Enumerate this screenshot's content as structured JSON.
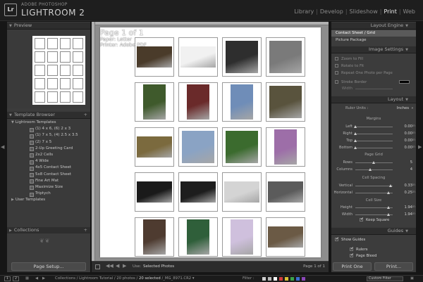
{
  "app": {
    "vendor": "ADOBE PHOTOSHOP",
    "name": "LIGHTROOM 2",
    "logo": "Lr",
    "modules": [
      "Library",
      "Develop",
      "Slideshow",
      "Print",
      "Web"
    ],
    "active_module": "Print"
  },
  "left": {
    "preview_title": "Preview",
    "template_browser_title": "Template Browser",
    "template_folder": "Lightroom Templates",
    "templates": [
      "(1) 4 x 6, (6) 2 x 3",
      "(1) 7 x 5, (4) 2.5 x 3.5",
      "(2) 7 x 5",
      "2-Up Greeting Card",
      "2x2 Cells",
      "4 Wide",
      "4x5 Contact Sheet",
      "5x8 Contact Sheet",
      "Fine Art Mat",
      "Maximize Size",
      "Triptych"
    ],
    "user_folder": "User Templates",
    "collections_title": "Collections",
    "page_setup_button": "Page Setup..."
  },
  "canvas": {
    "page_label": "Page 1 of 1",
    "paper_label": "Paper: Letter",
    "printer_label": "Printer: Adobe PDF"
  },
  "toolbar": {
    "use_label": "Use:",
    "use_value": "Selected Photos",
    "page_indicator": "Page 1 of 1"
  },
  "right": {
    "layout_engine_title": "Layout Engine",
    "layout_styles": [
      "Contact Sheet / Grid",
      "Picture Package"
    ],
    "selected_layout_style": "Contact Sheet / Grid",
    "image_settings_title": "Image Settings",
    "image_settings": [
      {
        "label": "Zoom to Fill",
        "checked": false
      },
      {
        "label": "Rotate to Fit",
        "checked": false
      },
      {
        "label": "Repeat One Photo per Page",
        "checked": false
      }
    ],
    "stroke_border_label": "Stroke Border",
    "stroke_width_label": "Width",
    "stroke_color": "#000000",
    "layout_title": "Layout",
    "ruler_units_label": "Ruler Units :",
    "ruler_units_value": "Inches",
    "margins_title": "Margins",
    "margins": [
      {
        "label": "Left",
        "value": "0.00",
        "unit": "in",
        "fraction": 0.0
      },
      {
        "label": "Right",
        "value": "0.00",
        "unit": "in",
        "fraction": 0.0
      },
      {
        "label": "Top",
        "value": "0.00",
        "unit": "in",
        "fraction": 0.0
      },
      {
        "label": "Bottom",
        "value": "0.00",
        "unit": "in",
        "fraction": 0.0
      }
    ],
    "page_grid_title": "Page Grid",
    "page_grid": [
      {
        "label": "Rows",
        "value": "5",
        "unit": "",
        "fraction": 0.5
      },
      {
        "label": "Columns",
        "value": "4",
        "unit": "",
        "fraction": 0.4
      }
    ],
    "cell_spacing_title": "Cell Spacing",
    "cell_spacing": [
      {
        "label": "Vertical",
        "value": "0.33",
        "unit": "in",
        "fraction": 0.95
      },
      {
        "label": "Horizontal",
        "value": "0.25",
        "unit": "in",
        "fraction": 0.9
      }
    ],
    "cell_size_title": "Cell Size",
    "cell_size": [
      {
        "label": "Height",
        "value": "1.94",
        "unit": "in",
        "fraction": 0.9
      },
      {
        "label": "Width",
        "value": "1.94",
        "unit": "in",
        "fraction": 0.9
      }
    ],
    "keep_square_label": "Keep Square",
    "guides_title": "Guides",
    "guides": [
      {
        "label": "Show Guides",
        "checked": true
      },
      {
        "label": "Rulers",
        "checked": true
      },
      {
        "label": "Page Bleed",
        "checked": true
      }
    ],
    "print_one_button": "Print One",
    "print_button": "Print..."
  },
  "filmstrip": {
    "page_buttons": [
      "1",
      "2"
    ],
    "path_prefix": "Collections / Lightroom Tutorial / 20 photos /",
    "selected_text": "20 selected",
    "file_name": "/_MG_8971.CR2",
    "filter_label": "Filter :",
    "flag_colors": [
      "#cfcfcf",
      "#b9b9b9",
      "#ffffff",
      "#d13b3b",
      "#d8c235",
      "#3aa34a",
      "#3b6ed1",
      "#8a46b8"
    ],
    "filter_dropdown": "Custom Filter"
  },
  "photos": [
    {
      "desc": "bookshelf",
      "bg": "#4a3b2a",
      "shape": "land"
    },
    {
      "desc": "camera-on-white",
      "bg": "#f1f1f1",
      "shape": "land"
    },
    {
      "desc": "bw-hands",
      "bg": "#2e2e2e",
      "shape": "square"
    },
    {
      "desc": "bw-girl-hood",
      "bg": "#7a7a7a",
      "shape": "square"
    },
    {
      "desc": "girl-pink-tree",
      "bg": "#3f5a2c",
      "shape": "port"
    },
    {
      "desc": "girl-red-hair",
      "bg": "#6a2a2a",
      "shape": "port"
    },
    {
      "desc": "yellow-machine-sky",
      "bg": "#6f8db8",
      "shape": "port"
    },
    {
      "desc": "yellow-tractor",
      "bg": "#59533d",
      "shape": "square"
    },
    {
      "desc": "yellow-bulldozer",
      "bg": "#7b6a3e",
      "shape": "land"
    },
    {
      "desc": "blonde-beanie",
      "bg": "#8aa3c4",
      "shape": "square"
    },
    {
      "desc": "girl-closeup-green",
      "bg": "#3b6b2e",
      "shape": "square"
    },
    {
      "desc": "girl-beanie-purple",
      "bg": "#9d6ea8",
      "shape": "port"
    },
    {
      "desc": "piano-keys",
      "bg": "#1a1a1a",
      "shape": "land"
    },
    {
      "desc": "bw-sitting",
      "bg": "#1d1d1d",
      "shape": "land"
    },
    {
      "desc": "bw-guitar",
      "bg": "#d4d4d4",
      "shape": "land"
    },
    {
      "desc": "bw-portrait",
      "bg": "#5b5b5b",
      "shape": "land"
    },
    {
      "desc": "girl-boots",
      "bg": "#4e3b30",
      "shape": "port"
    },
    {
      "desc": "green-hair-girl",
      "bg": "#2f5f3a",
      "shape": "port"
    },
    {
      "desc": "pink-figure",
      "bg": "#cfc0dd",
      "shape": "port"
    },
    {
      "desc": "indoor-couple",
      "bg": "#6b5a45",
      "shape": "land"
    }
  ]
}
